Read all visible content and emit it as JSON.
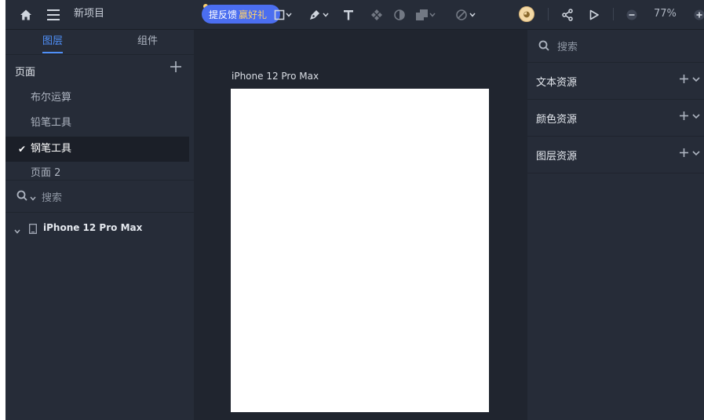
{
  "topbar": {
    "project_name": "新项目",
    "feedback_label": "提反馈",
    "feedback_reward": "赢好礼",
    "zoom": "77%"
  },
  "left_panel": {
    "tabs": [
      {
        "label": "图层",
        "active": true
      },
      {
        "label": "组件",
        "active": false
      }
    ],
    "pages_title": "页面",
    "pages": [
      {
        "label": "布尔运算",
        "active": false
      },
      {
        "label": "铅笔工具",
        "active": false
      },
      {
        "label": "钢笔工具",
        "active": true
      },
      {
        "label": "页面 2",
        "active": false
      }
    ],
    "search_placeholder": "搜索",
    "layers": [
      {
        "label": "iPhone 12 Pro Max",
        "type": "artboard",
        "expanded": true
      }
    ]
  },
  "canvas": {
    "artboard_label": "iPhone 12 Pro Max"
  },
  "right_panel": {
    "search_placeholder": "搜索",
    "assets": [
      {
        "label": "文本资源"
      },
      {
        "label": "颜色资源"
      },
      {
        "label": "图层资源"
      }
    ]
  },
  "colors": {
    "accent": "#4f8ff7",
    "feedback_pill": "#4b6ef0",
    "panel_bg": "#262c38",
    "canvas_bg": "#20252f"
  }
}
